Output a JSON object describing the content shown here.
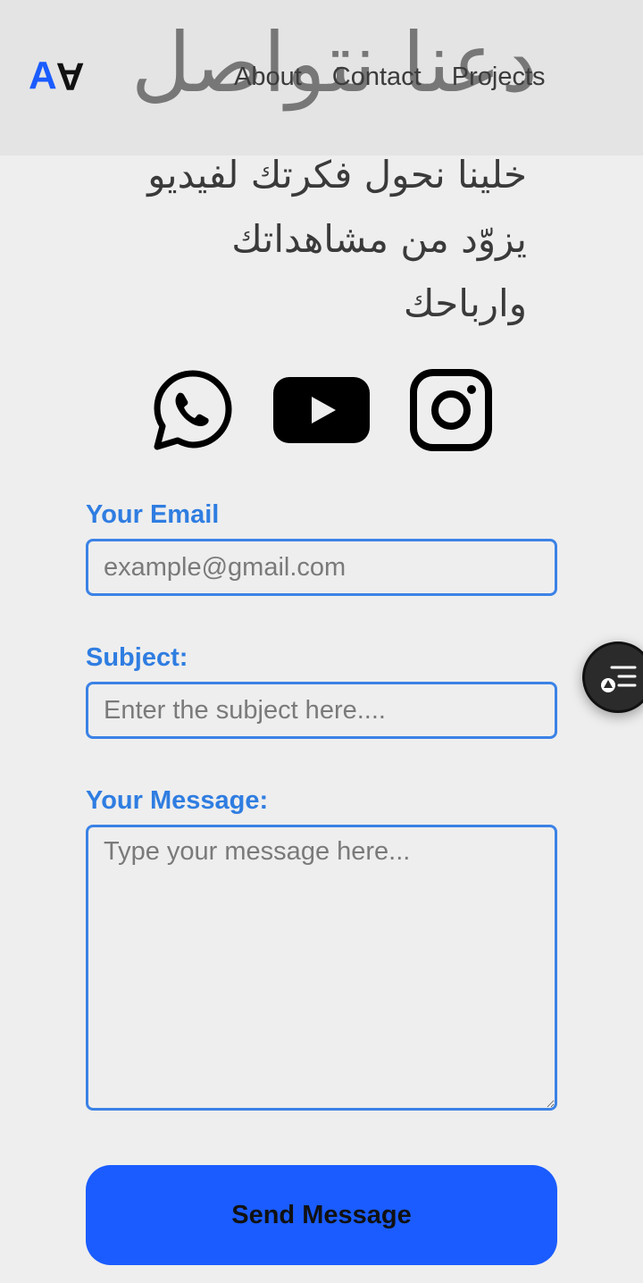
{
  "header": {
    "logo_a": "A",
    "logo_b": "A",
    "title": "دعنا نتواصل",
    "nav": [
      "About",
      "Contact",
      "Projects"
    ]
  },
  "hero": {
    "subtitle": "خلينا نحول فكرتك لفيديو يزوّد من مشاهداتك وارباحك"
  },
  "social": {
    "icons": [
      "whatsapp-icon",
      "youtube-icon",
      "instagram-icon"
    ]
  },
  "form": {
    "email_label": "Your Email",
    "email_placeholder": "example@gmail.com",
    "subject_label": "Subject:",
    "subject_placeholder": "Enter the subject here....",
    "message_label": "Your Message:",
    "message_placeholder": "Type your message here...",
    "send_label": "Send Message"
  },
  "colors": {
    "accent": "#1a5cff",
    "label_blue": "#2f7de1",
    "background": "#eeeeee"
  }
}
